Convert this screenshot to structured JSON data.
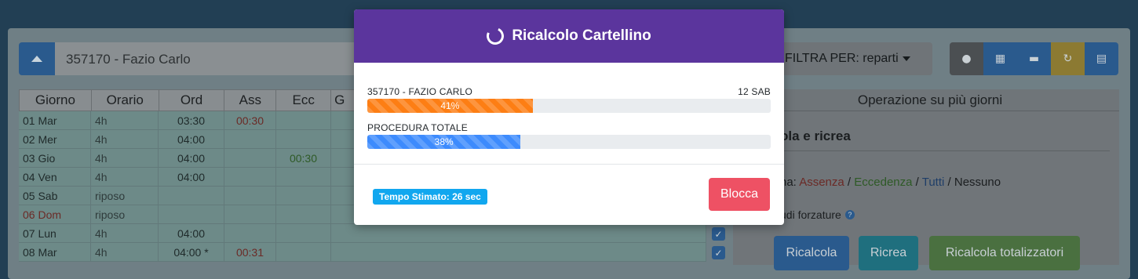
{
  "employee": {
    "value": "357170 - Fazio Carlo"
  },
  "filter": {
    "label": "FILTRA PER: reparti"
  },
  "toolbar": {
    "icons": [
      "map-marker-icon",
      "calculator-icon",
      "print-icon",
      "refresh-icon",
      "calendar-icon"
    ]
  },
  "grid": {
    "headers": [
      "Giorno",
      "Orario",
      "Ord",
      "Ass",
      "Ecc",
      "G"
    ],
    "rows": [
      {
        "giorno": "01 Mar",
        "orario": "4h",
        "ord": "03:30",
        "ass": "00:30",
        "ecc": ""
      },
      {
        "giorno": "02 Mer",
        "orario": "4h",
        "ord": "04:00",
        "ass": "",
        "ecc": ""
      },
      {
        "giorno": "03 Gio",
        "orario": "4h",
        "ord": "04:00",
        "ass": "",
        "ecc": "00:30"
      },
      {
        "giorno": "04 Ven",
        "orario": "4h",
        "ord": "04:00",
        "ass": "",
        "ecc": ""
      },
      {
        "giorno": "05 Sab",
        "orario": "riposo",
        "ord": "",
        "ass": "",
        "ecc": ""
      },
      {
        "giorno": "06 Dom",
        "orario": "riposo",
        "ord": "",
        "ass": "",
        "ecc": ""
      },
      {
        "giorno": "07 Lun",
        "orario": "4h",
        "ord": "04:00",
        "ass": "",
        "ecc": ""
      },
      {
        "giorno": "08 Mar",
        "orario": "4h",
        "ord": "04:00 *",
        "ass": "00:31",
        "ecc": ""
      }
    ]
  },
  "right_panel": {
    "header": "Operazione su più giorni",
    "title": "ola e ricrea",
    "filter_prefix": "na: ",
    "filter_assenza": "Assenza",
    "filter_eccedenza": "Eccedenza",
    "filter_tutti": "Tutti",
    "filter_nessuno": "Nessuno",
    "sep": " / ",
    "forzature": "udi forzature",
    "help": "?",
    "buttons": {
      "ricalcola": "Ricalcola",
      "ricrea": "Ricrea",
      "totalizzatori": "Ricalcola totalizzatori"
    }
  },
  "modal": {
    "title": "Ricalcolo Cartellino",
    "progress_1": {
      "label": "357170 - FAZIO CARLO",
      "right_label": "12 SAB",
      "percent": 41,
      "text": "41%",
      "color": "#fd7e14"
    },
    "progress_2": {
      "label": "PROCEDURA TOTALE",
      "percent": 38,
      "text": "38%",
      "color": "#3d8bfd"
    },
    "time_badge": "Tempo Stimato: 26 sec",
    "block_button": "Blocca"
  }
}
